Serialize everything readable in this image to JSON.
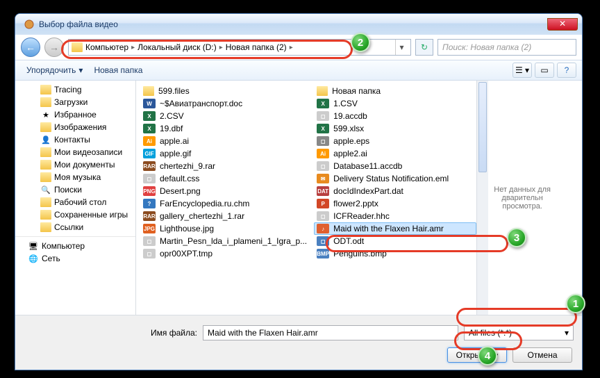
{
  "window": {
    "title": "Выбор файла видео"
  },
  "nav": {
    "crumbs": [
      "Компьютер",
      "Локальный диск (D:)",
      "Новая папка (2)"
    ],
    "search_placeholder": "Поиск: Новая папка (2)"
  },
  "toolbar": {
    "organize": "Упорядочить",
    "new_folder": "Новая папка"
  },
  "tree": [
    {
      "label": "Tracing",
      "icon": "folder"
    },
    {
      "label": "Загрузки",
      "icon": "folder"
    },
    {
      "label": "Избранное",
      "icon": "star"
    },
    {
      "label": "Изображения",
      "icon": "folder"
    },
    {
      "label": "Контакты",
      "icon": "contacts"
    },
    {
      "label": "Мои видеозаписи",
      "icon": "folder"
    },
    {
      "label": "Мои документы",
      "icon": "folder"
    },
    {
      "label": "Моя музыка",
      "icon": "folder"
    },
    {
      "label": "Поиски",
      "icon": "search"
    },
    {
      "label": "Рабочий стол",
      "icon": "folder"
    },
    {
      "label": "Сохраненные игры",
      "icon": "folder"
    },
    {
      "label": "Ссылки",
      "icon": "folder"
    }
  ],
  "tree_bottom": [
    {
      "label": "Компьютер",
      "icon": "computer"
    },
    {
      "label": "Сеть",
      "icon": "network"
    }
  ],
  "files_col1": [
    {
      "name": "599.files",
      "icon": "folder",
      "color": "#f4c54a"
    },
    {
      "name": "~$Авиатранспорт.doc",
      "icon": "W",
      "color": "#2b579a"
    },
    {
      "name": "2.CSV",
      "icon": "X",
      "color": "#217346"
    },
    {
      "name": "19.dbf",
      "icon": "X",
      "color": "#217346"
    },
    {
      "name": "apple.ai",
      "icon": "Ai",
      "color": "#ff9a00"
    },
    {
      "name": "apple.gif",
      "icon": "GIF",
      "color": "#00a0dc"
    },
    {
      "name": "chertezhi_9.rar",
      "icon": "RAR",
      "color": "#8b4b1f"
    },
    {
      "name": "default.css",
      "icon": "◻",
      "color": "#ccc"
    },
    {
      "name": "Desert.png",
      "icon": "PNG",
      "color": "#e04040"
    },
    {
      "name": "FarEncyclopedia.ru.chm",
      "icon": "?",
      "color": "#3478c0"
    },
    {
      "name": "gallery_chertezhi_1.rar",
      "icon": "RAR",
      "color": "#8b4b1f"
    },
    {
      "name": "Lighthouse.jpg",
      "icon": "JPG",
      "color": "#e06020"
    },
    {
      "name": "Martin_Pesn_lda_i_plameni_1_Igra_p...",
      "icon": "◻",
      "color": "#ccc"
    },
    {
      "name": "opr00XPT.tmp",
      "icon": "◻",
      "color": "#ccc"
    }
  ],
  "files_col2": [
    {
      "name": "Новая папка",
      "icon": "folder",
      "color": "#f4c54a"
    },
    {
      "name": "1.CSV",
      "icon": "X",
      "color": "#217346"
    },
    {
      "name": "19.accdb",
      "icon": "◻",
      "color": "#ccc"
    },
    {
      "name": "599.xlsx",
      "icon": "X",
      "color": "#217346"
    },
    {
      "name": "apple.eps",
      "icon": "◻",
      "color": "#888"
    },
    {
      "name": "apple2.ai",
      "icon": "Ai",
      "color": "#ff9a00"
    },
    {
      "name": "Database11.accdb",
      "icon": "◻",
      "color": "#ccc"
    },
    {
      "name": "Delivery Status Notification.eml",
      "icon": "✉",
      "color": "#e88b1f"
    },
    {
      "name": "docIdIndexPart.dat",
      "icon": "DAT",
      "color": "#b84040"
    },
    {
      "name": "flower2.pptx",
      "icon": "P",
      "color": "#d24726"
    },
    {
      "name": "ICFReader.hhc",
      "icon": "◻",
      "color": "#ccc"
    },
    {
      "name": "Maid with the Flaxen Hair.amr",
      "icon": "♪",
      "color": "#e06030",
      "selected": true
    },
    {
      "name": "ODT.odt",
      "icon": "◻",
      "color": "#4a80c0"
    },
    {
      "name": "Penguins.bmp",
      "icon": "BMP",
      "color": "#4a80c0"
    }
  ],
  "preview": {
    "text": "Нет данных для дварительн просмотра."
  },
  "bottom": {
    "filename_label": "Имя файла:",
    "filename_value": "Maid with the Flaxen Hair.amr",
    "filetype": "All files (*.*)",
    "open": "Открыть",
    "cancel": "Отмена"
  },
  "callouts": {
    "c1": "1",
    "c2": "2",
    "c3": "3",
    "c4": "4"
  }
}
